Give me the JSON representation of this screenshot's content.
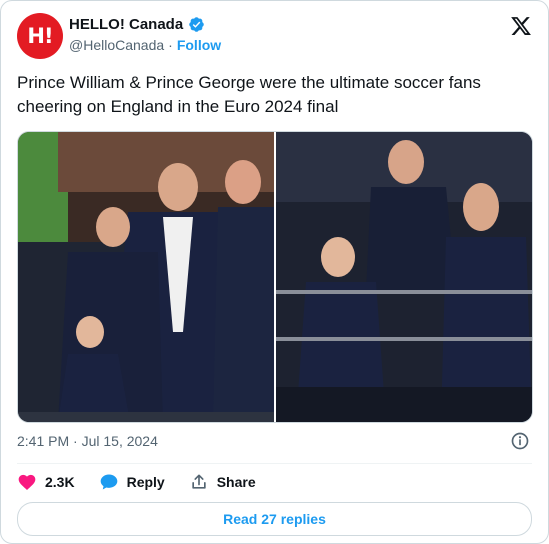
{
  "account": {
    "avatar_text": "H!",
    "display_name": "HELLO! Canada",
    "handle": "@HelloCanada",
    "separator": "·",
    "follow_label": "Follow"
  },
  "tweet": {
    "text": "Prince William & Prince George were the ultimate soccer fans cheering on England in the Euro 2024 final",
    "timestamp": "2:41 PM · Jul 15, 2024"
  },
  "actions": {
    "likes_count": "2.3K",
    "reply_label": "Reply",
    "share_label": "Share",
    "read_replies_label": "Read 27 replies"
  },
  "colors": {
    "brand_red": "#e31b23",
    "link_blue": "#1d9bf0",
    "like_pink": "#f91880"
  }
}
